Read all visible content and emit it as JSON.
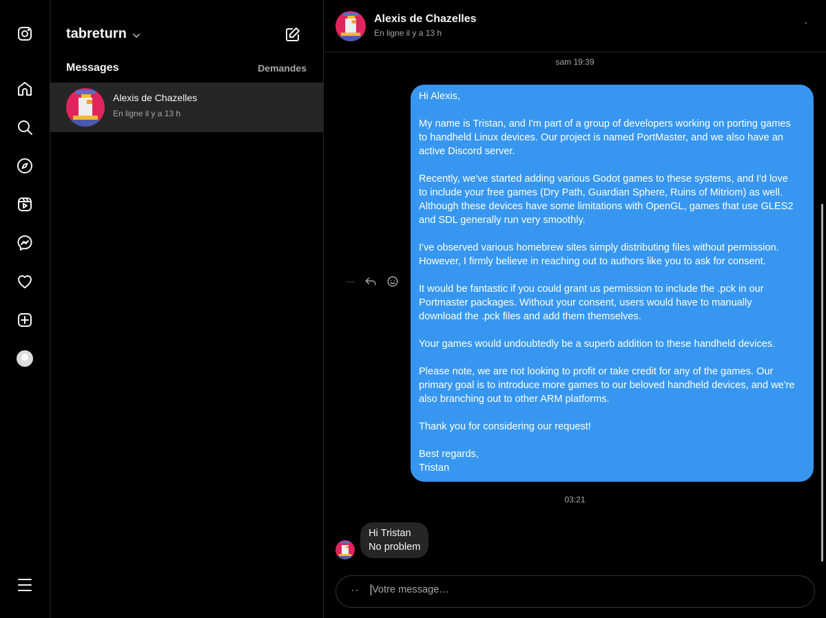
{
  "nav": {
    "items": [
      "instagram",
      "home",
      "search",
      "explore",
      "reels",
      "messenger",
      "notifications",
      "create",
      "profile",
      "more"
    ]
  },
  "inbox": {
    "username": "tabreturn",
    "messages_label": "Messages",
    "requests_label": "Demandes",
    "conversations": [
      {
        "name": "Alexis de Chazelles",
        "status": "En ligne il y a 13 h"
      }
    ]
  },
  "chat": {
    "name": "Alexis de Chazelles",
    "status": "En ligne il y a 13 h",
    "timestamp1": "sam 19:39",
    "timestamp2": "03:21",
    "sent_message": [
      [
        "Hi Alexis,"
      ],
      [
        "My name is Tristan, and I'm part of a group of developers working on porting games",
        "to handheld Linux devices. Our project is named PortMaster, and we also have an",
        "active Discord server."
      ],
      [
        "Recently, we've started adding various Godot games to these systems, and I'd love",
        "to include your free games (Dry Path, Guardian Sphere, Ruins of Mitriom) as well.",
        "Although these devices have some limitations with OpenGL, games that use GLES2",
        "and SDL generally run very smoothly."
      ],
      [
        "I've observed various homebrew sites simply distributing files without permission.",
        "However, I firmly believe in reaching out to authors like you to ask for consent."
      ],
      [
        "It would be fantastic if you could grant us permission to include the .pck in our",
        "Portmaster packages. Without your consent, users would have to manually",
        "download the .pck files and add them themselves."
      ],
      [
        "Your games would undoubtedly be a superb addition to these handheld devices."
      ],
      [
        "Please note, we are not looking to profit or take credit for any of the games. Our",
        "primary goal is to introduce more games to our beloved handheld devices, and we're",
        "also branching out to other ARM platforms."
      ],
      [
        "Thank you for considering our request!"
      ],
      [
        "Best regards,",
        "Tristan"
      ]
    ],
    "received_message": [
      "Hi Tristan",
      "No problem"
    ],
    "more_label": "···",
    "composer_placeholder": "Votre message…"
  },
  "colors": {
    "accent": "#3797f0",
    "bubble_in": "#262626",
    "avatar_bg": "#e0245e"
  }
}
